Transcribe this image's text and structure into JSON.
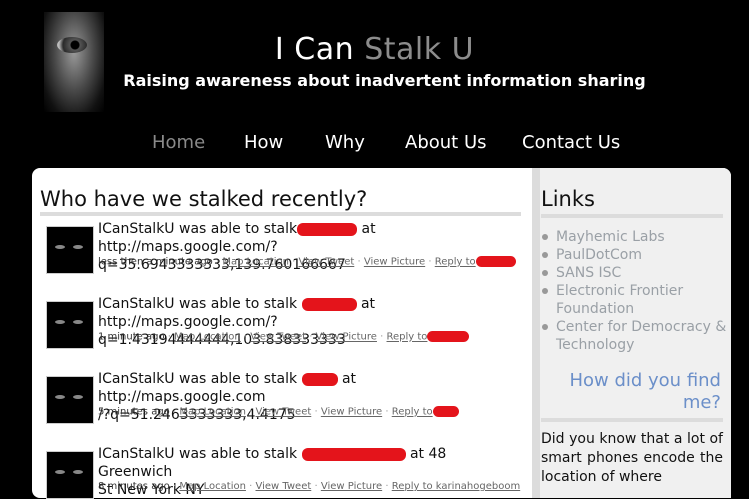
{
  "header": {
    "title_part1": "I Can",
    "title_part2": "Stalk U",
    "tagline": "Raising awareness about inadvertent information sharing"
  },
  "nav": {
    "items": [
      {
        "label": "Home",
        "active": true
      },
      {
        "label": "How"
      },
      {
        "label": "Why"
      },
      {
        "label": "About Us"
      },
      {
        "label": "Contact Us"
      }
    ]
  },
  "main": {
    "heading": "Who have we stalked recently?",
    "tweets": [
      {
        "line1_prefix": "ICanStalkU was able to stalk",
        "line1_suffix": "at",
        "line2": "http://maps.google.com/?q=35.6943333333,139.760166667",
        "time": "less then a minute ago",
        "map": "Map Location",
        "tweet": "View Tweet",
        "picture": "View Picture",
        "reply": "Reply to"
      },
      {
        "line1_prefix": "ICanStalkU was able to stalk",
        "line1_suffix": "at",
        "line2": "http://maps.google.com/?q=1.43194444444,103.838333333",
        "time": "1 minute ago",
        "map": "Map Location",
        "tweet": "View Tweet",
        "picture": "View Picture",
        "reply": "Reply to"
      },
      {
        "line1_prefix": "ICanStalkU was able to stalk",
        "line1_suffix": "at http://maps.google.com",
        "line2": "/?q=51.2463333333,4.4175",
        "time": "5 minutes ago",
        "map": "Map Location",
        "tweet": "View Tweet",
        "picture": "View Picture",
        "reply": "Reply to"
      },
      {
        "line1_prefix": "ICanStalkU was able to stalk",
        "line1_suffix": "at 48 Greenwich",
        "line2": "St New York NY",
        "time": "8 minutes ago",
        "map": "Map Location",
        "tweet": "View Tweet",
        "picture": "View Picture",
        "reply": "Reply to karinahogeboom"
      }
    ]
  },
  "sidebar": {
    "heading": "Links",
    "links": [
      "Mayhemic Labs",
      "PaulDotCom",
      "SANS ISC",
      "Electronic Frontier Foundation",
      "Center for Democracy & Technology"
    ],
    "how_did_you_find": "How did you find me?",
    "did_you_know": "Did you know that a lot of smart phones encode the location of where"
  },
  "colors": {
    "background": "#000000",
    "title_grey": "#8c8c8c",
    "link_blue": "#6b8fc9",
    "redaction": "#e4141b"
  }
}
